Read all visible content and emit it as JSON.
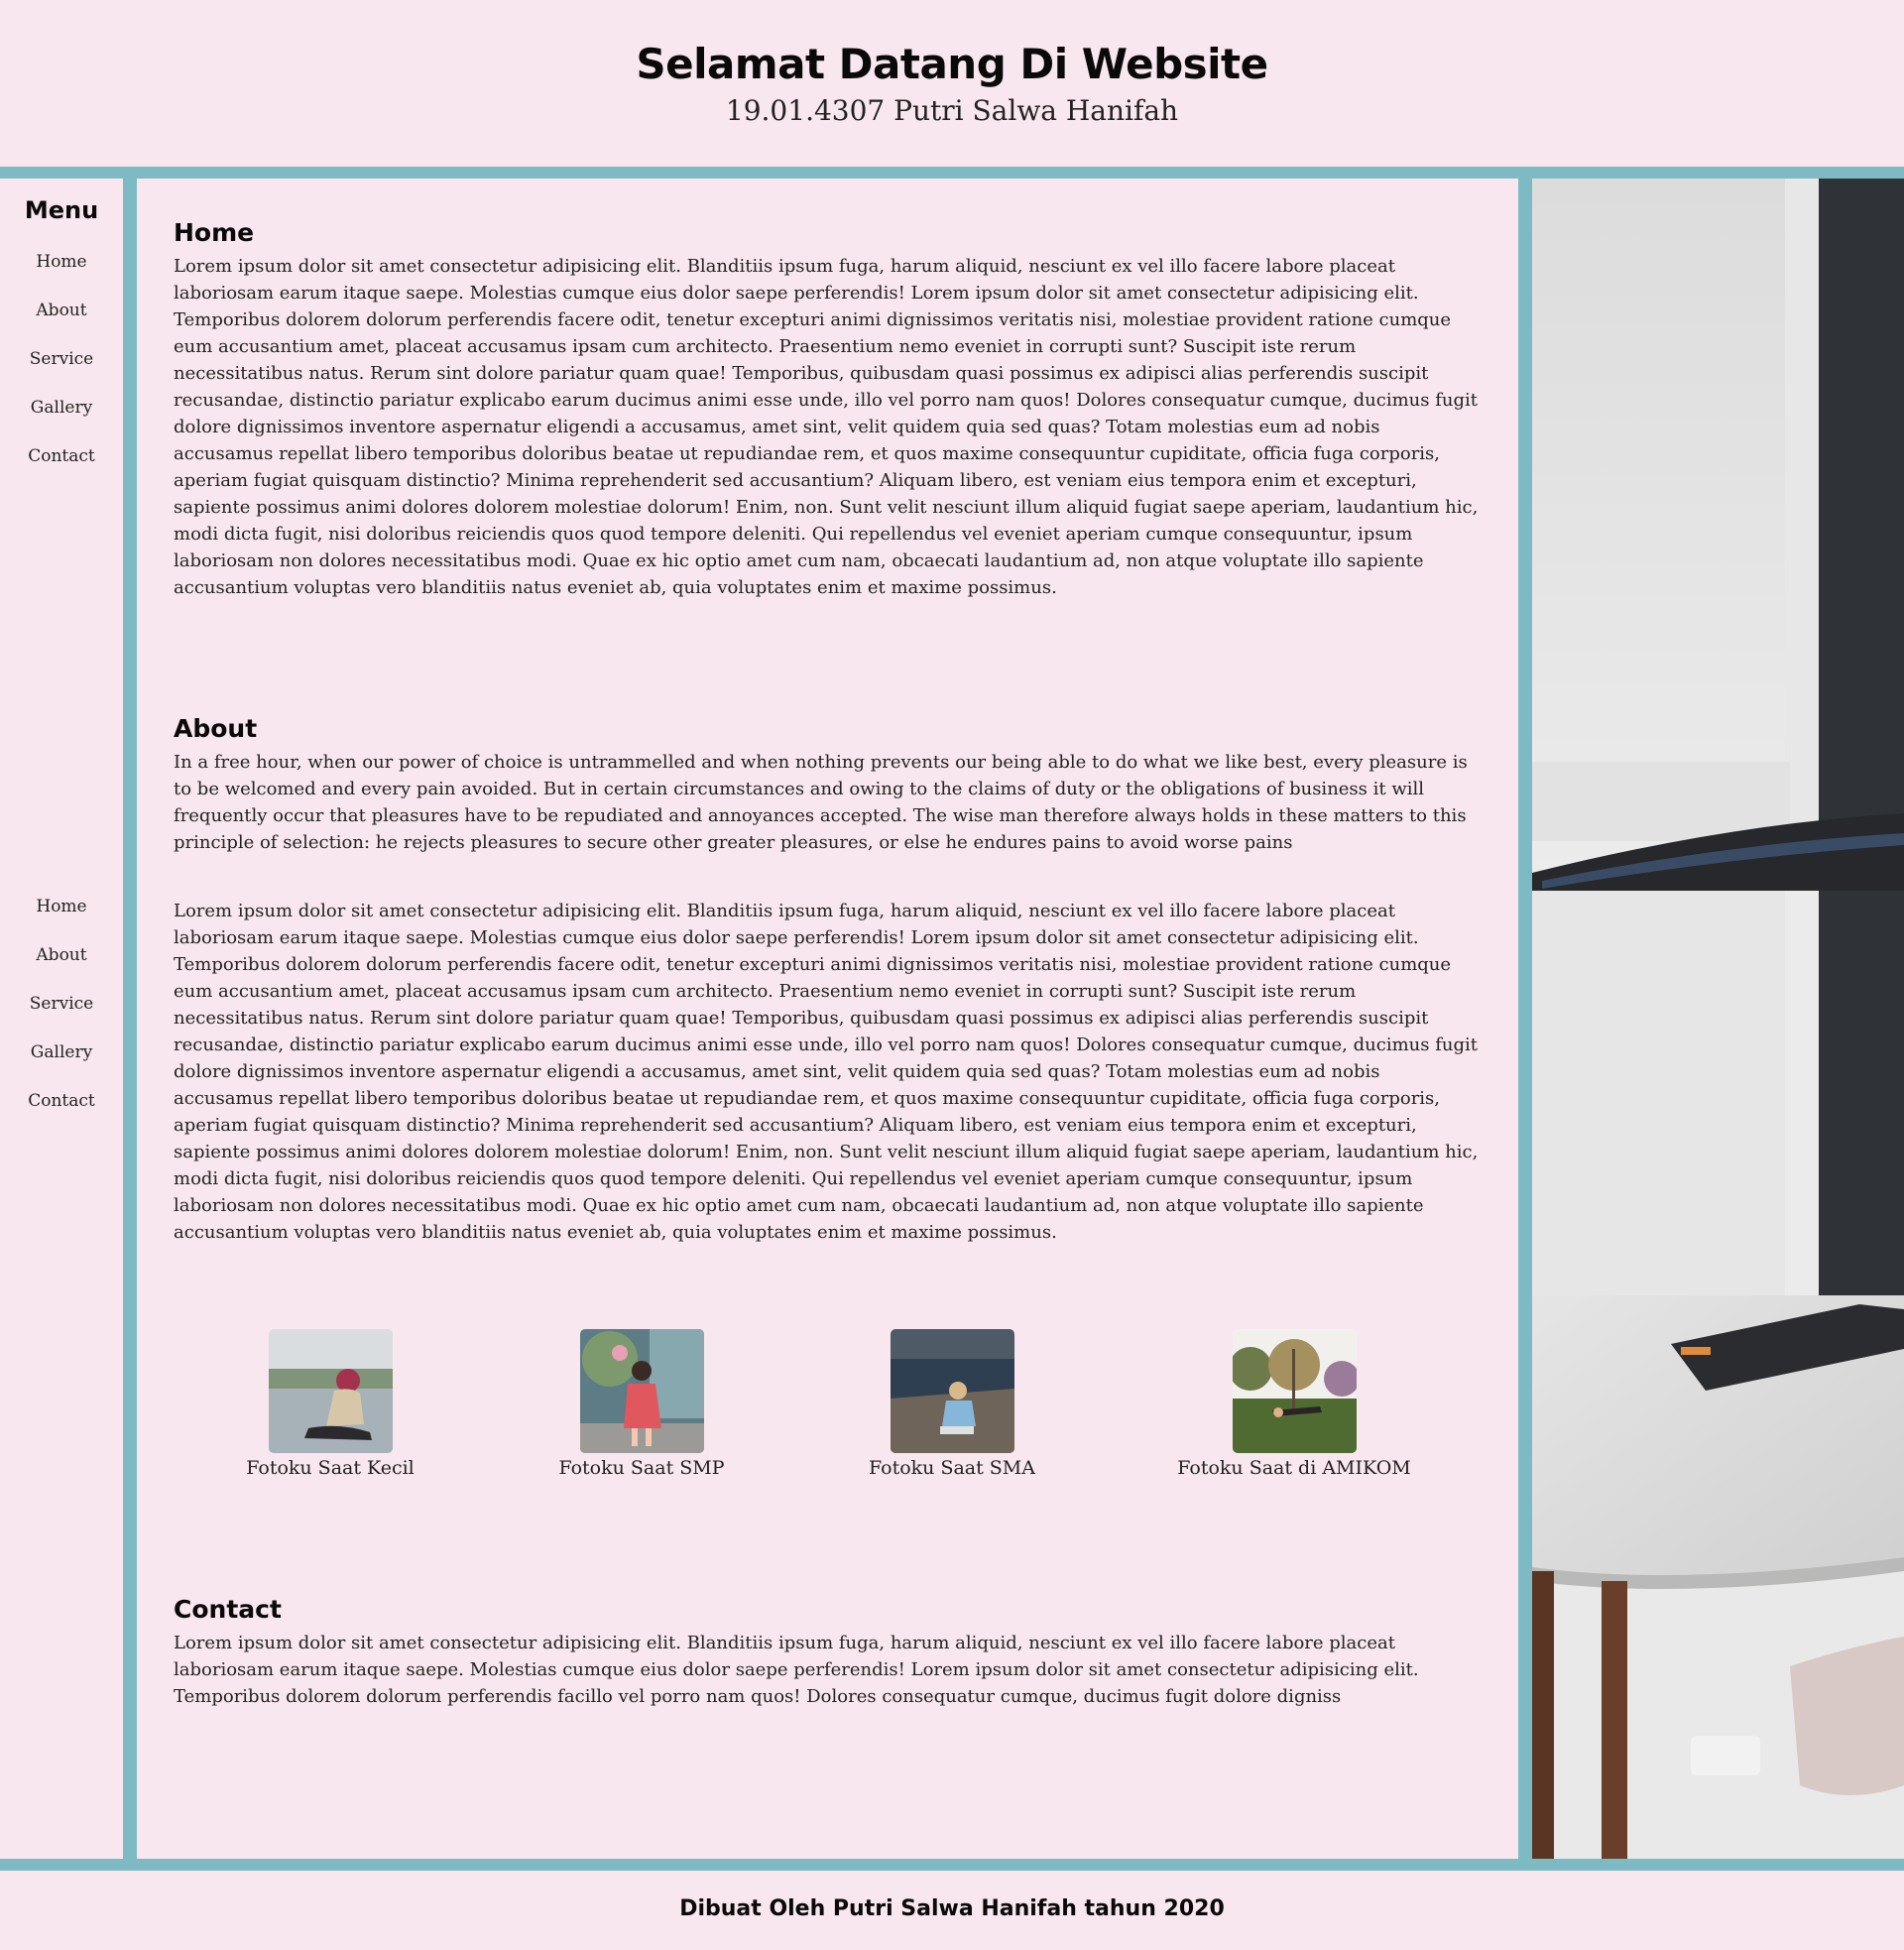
{
  "header": {
    "title": "Selamat Datang Di Website",
    "subtitle": "19.01.4307 Putri Salwa Hanifah"
  },
  "sidebar": {
    "menu_title": "Menu",
    "items": [
      "Home",
      "About",
      "Service",
      "Gallery",
      "Contact"
    ],
    "items_repeat": [
      "Home",
      "About",
      "Service",
      "Gallery",
      "Contact"
    ]
  },
  "main": {
    "home": {
      "title": "Home",
      "text": "Lorem ipsum dolor sit amet consectetur adipisicing elit. Blanditiis ipsum fuga, harum aliquid, nesciunt ex vel illo facere labore placeat laboriosam earum itaque saepe. Molestias cumque eius dolor saepe perferendis! Lorem ipsum dolor sit amet consectetur adipisicing elit. Temporibus dolorem dolorum perferendis facere odit, tenetur excepturi animi dignissimos veritatis nisi, molestiae provident ratione cumque eum accusantium amet, placeat accusamus ipsam cum architecto. Praesentium nemo eveniet in corrupti sunt? Suscipit iste rerum necessitatibus natus. Rerum sint dolore pariatur quam quae! Temporibus, quibusdam quasi possimus ex adipisci alias perferendis suscipit recusandae, distinctio pariatur explicabo earum ducimus animi esse unde, illo vel porro nam quos! Dolores consequatur cumque, ducimus fugit dolore dignissimos inventore aspernatur eligendi a accusamus, amet sint, velit quidem quia sed quas? Totam molestias eum ad nobis accusamus repellat libero temporibus doloribus beatae ut repudiandae rem, et quos maxime consequuntur cupiditate, officia fuga corporis, aperiam fugiat quisquam distinctio? Minima reprehenderit sed accusantium? Aliquam libero, est veniam eius tempora enim et excepturi, sapiente possimus animi dolores dolorem molestiae dolorum! Enim, non. Sunt velit nesciunt illum aliquid fugiat saepe aperiam, laudantium hic, modi dicta fugit, nisi doloribus reiciendis quos quod tempore deleniti. Qui repellendus vel eveniet aperiam cumque consequuntur, ipsum laboriosam non dolores necessitatibus modi. Quae ex hic optio amet cum nam, obcaecati laudantium ad, non atque voluptate illo sapiente accusantium voluptas vero blanditiis natus eveniet ab, quia voluptates enim et maxime possimus."
    },
    "about": {
      "title": "About",
      "text": "In a free hour, when our power of choice is untrammelled and when nothing prevents our being able to do what we like best, every pleasure is to be welcomed and every pain avoided. But in certain circumstances and owing to the claims of duty or the obligations of business it will frequently occur that pleasures have to be repudiated and annoyances accepted. The wise man therefore always holds in these matters to this principle of selection: he rejects pleasures to secure other greater pleasures, or else he endures pains to avoid worse pains"
    },
    "service": {
      "text": "Lorem ipsum dolor sit amet consectetur adipisicing elit. Blanditiis ipsum fuga, harum aliquid, nesciunt ex vel illo facere labore placeat laboriosam earum itaque saepe. Molestias cumque eius dolor saepe perferendis! Lorem ipsum dolor sit amet consectetur adipisicing elit. Temporibus dolorem dolorum perferendis facere odit, tenetur excepturi animi dignissimos veritatis nisi, molestiae provident ratione cumque eum accusantium amet, placeat accusamus ipsam cum architecto. Praesentium nemo eveniet in corrupti sunt? Suscipit iste rerum necessitatibus natus. Rerum sint dolore pariatur quam quae! Temporibus, quibusdam quasi possimus ex adipisci alias perferendis suscipit recusandae, distinctio pariatur explicabo earum ducimus animi esse unde, illo vel porro nam quos! Dolores consequatur cumque, ducimus fugit dolore dignissimos inventore aspernatur eligendi a accusamus, amet sint, velit quidem quia sed quas? Totam molestias eum ad nobis accusamus repellat libero temporibus doloribus beatae ut repudiandae rem, et quos maxime consequuntur cupiditate, officia fuga corporis, aperiam fugiat quisquam distinctio? Minima reprehenderit sed accusantium? Aliquam libero, est veniam eius tempora enim et excepturi, sapiente possimus animi dolores dolorem molestiae dolorum! Enim, non. Sunt velit nesciunt illum aliquid fugiat saepe aperiam, laudantium hic, modi dicta fugit, nisi doloribus reiciendis quos quod tempore deleniti. Qui repellendus vel eveniet aperiam cumque consequuntur, ipsum laboriosam non dolores necessitatibus modi. Quae ex hic optio amet cum nam, obcaecati laudantium ad, non atque voluptate illo sapiente accusantium voluptas vero blanditiis natus eveniet ab, quia voluptates enim et maxime possimus."
    },
    "gallery": {
      "items": [
        {
          "caption": "Fotoku Saat Kecil"
        },
        {
          "caption": "Fotoku Saat SMP"
        },
        {
          "caption": "Fotoku Saat SMA"
        },
        {
          "caption": "Fotoku Saat di AMIKOM"
        }
      ]
    },
    "contact": {
      "title": "Contact",
      "text": "Lorem ipsum dolor sit amet consectetur adipisicing elit. Blanditiis ipsum fuga, harum aliquid, nesciunt ex vel illo facere labore placeat laboriosam earum itaque saepe. Molestias cumque eius dolor saepe perferendis! Lorem ipsum dolor sit amet consectetur adipisicing elit. Temporibus dolorem dolorum perferendis facillo vel porro nam quos! Dolores consequatur cumque, ducimus fugit dolore digniss"
    }
  },
  "footer": {
    "text": "Dibuat Oleh Putri Salwa Hanifah tahun 2020"
  },
  "colors": {
    "background": "#f8e7ee",
    "accent_bar": "#7ebac3"
  }
}
